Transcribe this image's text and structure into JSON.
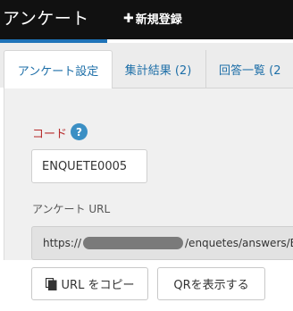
{
  "navbar": {
    "brand": "アンケート",
    "new_label": "新規登録",
    "new_icon": "plus-icon"
  },
  "tabs": [
    {
      "label": "アンケート設定",
      "active": true
    },
    {
      "label": "集計結果 (2)",
      "active": false
    },
    {
      "label": "回答一覧 (2",
      "active": false
    }
  ],
  "form": {
    "code_label": "コード",
    "help_icon": "?",
    "code_value": "ENQUETE0005",
    "url_label": "アンケート URL",
    "url_prefix": "https://",
    "url_suffix": "/enquetes/answers/E"
  },
  "buttons": {
    "copy_label": "URL をコピー",
    "qr_label": "QRを表示する"
  },
  "colors": {
    "accent": "#1e73b8",
    "required": "#b82d2d",
    "help": "#3b8fc4"
  }
}
